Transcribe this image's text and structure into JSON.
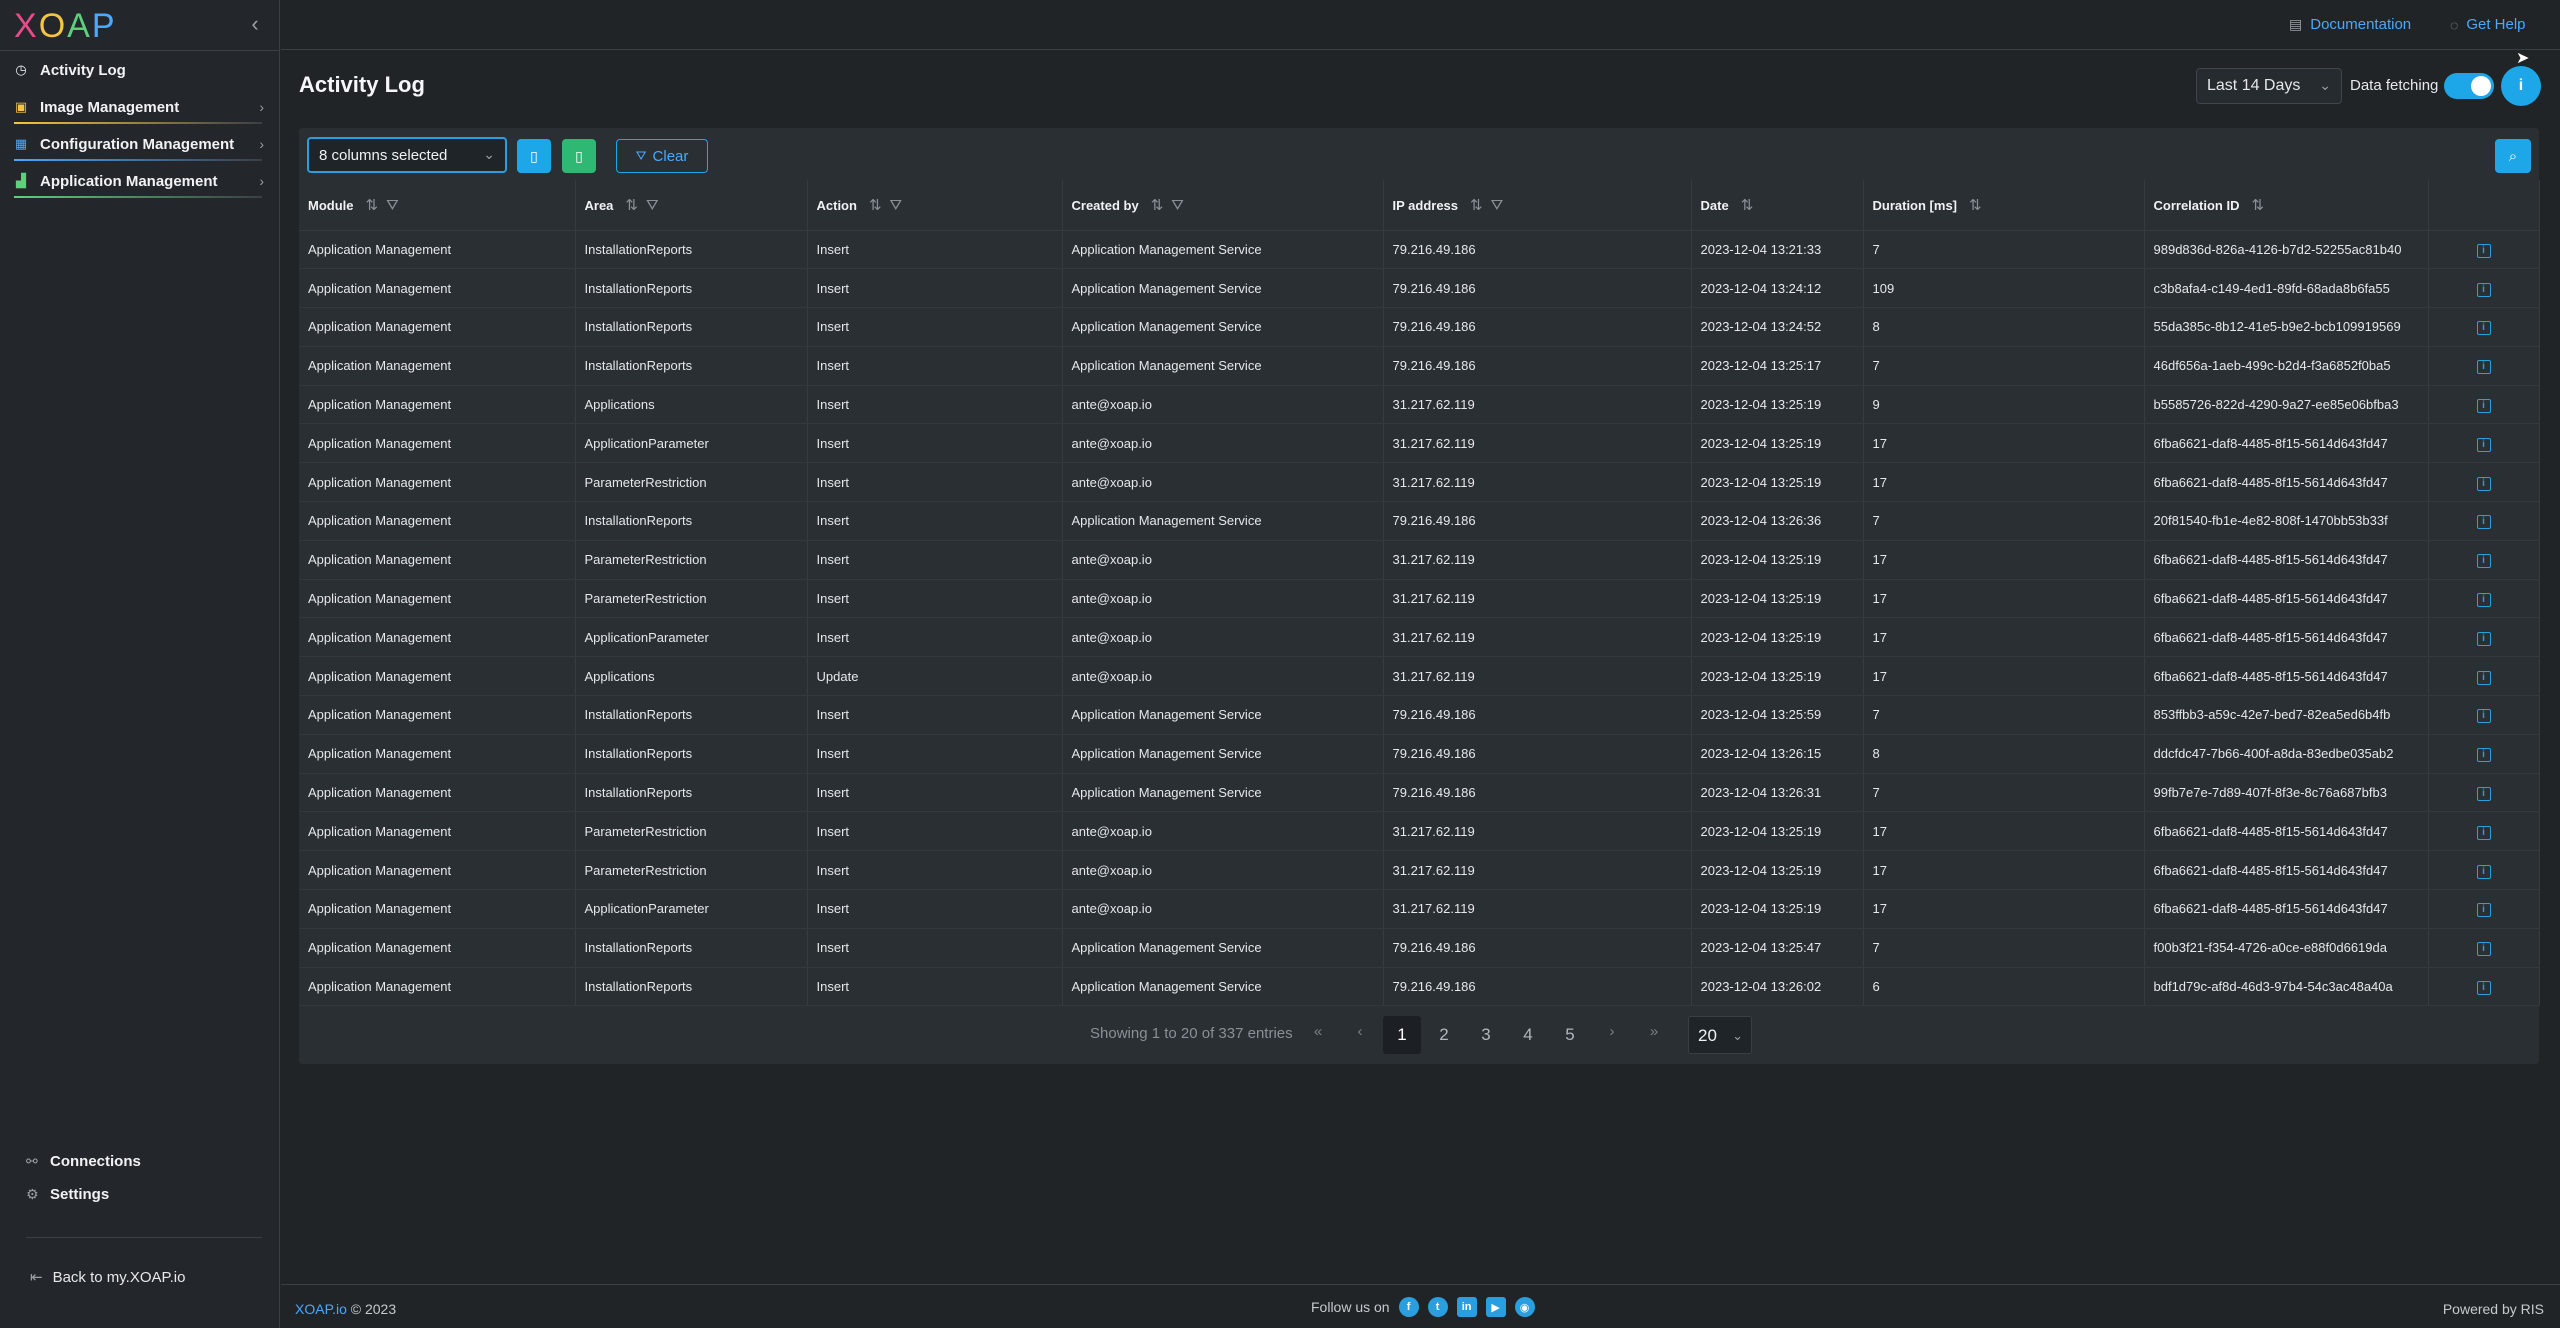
{
  "logo": {
    "text_1": "X",
    "text_2": "O",
    "text_3": "A",
    "text_4": "P"
  },
  "topbar": {
    "documentation": "Documentation",
    "get_help": "Get Help"
  },
  "sidebar": {
    "items": [
      {
        "label": "Activity Log"
      },
      {
        "label": "Image Management"
      },
      {
        "label": "Configuration Management"
      },
      {
        "label": "Application Management"
      }
    ],
    "connections": "Connections",
    "settings": "Settings",
    "back": "Back to my.XOAP.io"
  },
  "header": {
    "title": "Activity Log",
    "range": "Last 14 Days",
    "data_fetching": "Data fetching",
    "info": "i"
  },
  "toolbar": {
    "columns": "8 columns selected",
    "clear": "Clear"
  },
  "table": {
    "headers": [
      "Module",
      "Area",
      "Action",
      "Created by",
      "IP address",
      "Date",
      "Duration [ms]",
      "Correlation ID"
    ],
    "rows": [
      [
        "Application Management",
        "InstallationReports",
        "Insert",
        "Application Management Service",
        "79.216.49.186",
        "2023-12-04 13:21:33",
        "7",
        "989d836d-826a-4126-b7d2-52255ac81b40"
      ],
      [
        "Application Management",
        "InstallationReports",
        "Insert",
        "Application Management Service",
        "79.216.49.186",
        "2023-12-04 13:24:12",
        "109",
        "c3b8afa4-c149-4ed1-89fd-68ada8b6fa55"
      ],
      [
        "Application Management",
        "InstallationReports",
        "Insert",
        "Application Management Service",
        "79.216.49.186",
        "2023-12-04 13:24:52",
        "8",
        "55da385c-8b12-41e5-b9e2-bcb109919569"
      ],
      [
        "Application Management",
        "InstallationReports",
        "Insert",
        "Application Management Service",
        "79.216.49.186",
        "2023-12-04 13:25:17",
        "7",
        "46df656a-1aeb-499c-b2d4-f3a6852f0ba5"
      ],
      [
        "Application Management",
        "Applications",
        "Insert",
        "ante@xoap.io",
        "31.217.62.119",
        "2023-12-04 13:25:19",
        "9",
        "b5585726-822d-4290-9a27-ee85e06bfba3"
      ],
      [
        "Application Management",
        "ApplicationParameter",
        "Insert",
        "ante@xoap.io",
        "31.217.62.119",
        "2023-12-04 13:25:19",
        "17",
        "6fba6621-daf8-4485-8f15-5614d643fd47"
      ],
      [
        "Application Management",
        "ParameterRestriction",
        "Insert",
        "ante@xoap.io",
        "31.217.62.119",
        "2023-12-04 13:25:19",
        "17",
        "6fba6621-daf8-4485-8f15-5614d643fd47"
      ],
      [
        "Application Management",
        "InstallationReports",
        "Insert",
        "Application Management Service",
        "79.216.49.186",
        "2023-12-04 13:26:36",
        "7",
        "20f81540-fb1e-4e82-808f-1470bb53b33f"
      ],
      [
        "Application Management",
        "ParameterRestriction",
        "Insert",
        "ante@xoap.io",
        "31.217.62.119",
        "2023-12-04 13:25:19",
        "17",
        "6fba6621-daf8-4485-8f15-5614d643fd47"
      ],
      [
        "Application Management",
        "ParameterRestriction",
        "Insert",
        "ante@xoap.io",
        "31.217.62.119",
        "2023-12-04 13:25:19",
        "17",
        "6fba6621-daf8-4485-8f15-5614d643fd47"
      ],
      [
        "Application Management",
        "ApplicationParameter",
        "Insert",
        "ante@xoap.io",
        "31.217.62.119",
        "2023-12-04 13:25:19",
        "17",
        "6fba6621-daf8-4485-8f15-5614d643fd47"
      ],
      [
        "Application Management",
        "Applications",
        "Update",
        "ante@xoap.io",
        "31.217.62.119",
        "2023-12-04 13:25:19",
        "17",
        "6fba6621-daf8-4485-8f15-5614d643fd47"
      ],
      [
        "Application Management",
        "InstallationReports",
        "Insert",
        "Application Management Service",
        "79.216.49.186",
        "2023-12-04 13:25:59",
        "7",
        "853ffbb3-a59c-42e7-bed7-82ea5ed6b4fb"
      ],
      [
        "Application Management",
        "InstallationReports",
        "Insert",
        "Application Management Service",
        "79.216.49.186",
        "2023-12-04 13:26:15",
        "8",
        "ddcfdc47-7b66-400f-a8da-83edbe035ab2"
      ],
      [
        "Application Management",
        "InstallationReports",
        "Insert",
        "Application Management Service",
        "79.216.49.186",
        "2023-12-04 13:26:31",
        "7",
        "99fb7e7e-7d89-407f-8f3e-8c76a687bfb3"
      ],
      [
        "Application Management",
        "ParameterRestriction",
        "Insert",
        "ante@xoap.io",
        "31.217.62.119",
        "2023-12-04 13:25:19",
        "17",
        "6fba6621-daf8-4485-8f15-5614d643fd47"
      ],
      [
        "Application Management",
        "ParameterRestriction",
        "Insert",
        "ante@xoap.io",
        "31.217.62.119",
        "2023-12-04 13:25:19",
        "17",
        "6fba6621-daf8-4485-8f15-5614d643fd47"
      ],
      [
        "Application Management",
        "ApplicationParameter",
        "Insert",
        "ante@xoap.io",
        "31.217.62.119",
        "2023-12-04 13:25:19",
        "17",
        "6fba6621-daf8-4485-8f15-5614d643fd47"
      ],
      [
        "Application Management",
        "InstallationReports",
        "Insert",
        "Application Management Service",
        "79.216.49.186",
        "2023-12-04 13:25:47",
        "7",
        "f00b3f21-f354-4726-a0ce-e88f0d6619da"
      ],
      [
        "Application Management",
        "InstallationReports",
        "Insert",
        "Application Management Service",
        "79.216.49.186",
        "2023-12-04 13:26:02",
        "6",
        "bdf1d79c-af8d-46d3-97b4-54c3ac48a40a"
      ]
    ]
  },
  "pagination": {
    "info": "Showing 1 to 20 of 337 entries",
    "pages": [
      "1",
      "2",
      "3",
      "4",
      "5"
    ],
    "page_size": "20"
  },
  "footer": {
    "brand": "XOAP.io",
    "copyright": " © 2023",
    "follow": "Follow us on",
    "powered": "Powered by RIS"
  },
  "colors": {
    "accent": "#1ea7e8",
    "success": "#2eb873",
    "background": "#202427"
  }
}
